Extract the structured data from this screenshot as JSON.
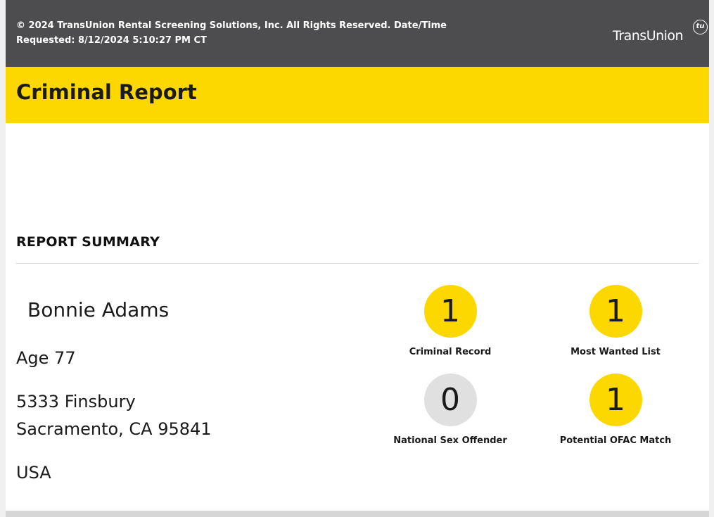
{
  "header": {
    "copyright": "© 2024 TransUnion Rental Screening Solutions, Inc. All Rights Reserved. Date/Time Requested: 8/12/2024 5:10:27 PM CT",
    "logo_text": "TransUnion",
    "logo_mark": "tu"
  },
  "report": {
    "title": "Criminal Report",
    "section_heading": "REPORT SUMMARY"
  },
  "subject": {
    "name": "Bonnie Adams",
    "age": "Age 77",
    "address_line1": "5333 Finsbury",
    "address_line2": "Sacramento, CA 95841",
    "country": "USA"
  },
  "stats": [
    {
      "count": "1",
      "label": "Criminal Record",
      "color": "#fcd800"
    },
    {
      "count": "1",
      "label": "Most Wanted List",
      "color": "#fcd800"
    },
    {
      "count": "0",
      "label": "National Sex Offender",
      "color": "#e0e0e0"
    },
    {
      "count": "1",
      "label": "Potential OFAC Match",
      "color": "#fcd800"
    }
  ],
  "colors": {
    "header_bg": "#4d4d4f",
    "accent": "#fcd800",
    "zero_badge": "#e0e0e0"
  }
}
